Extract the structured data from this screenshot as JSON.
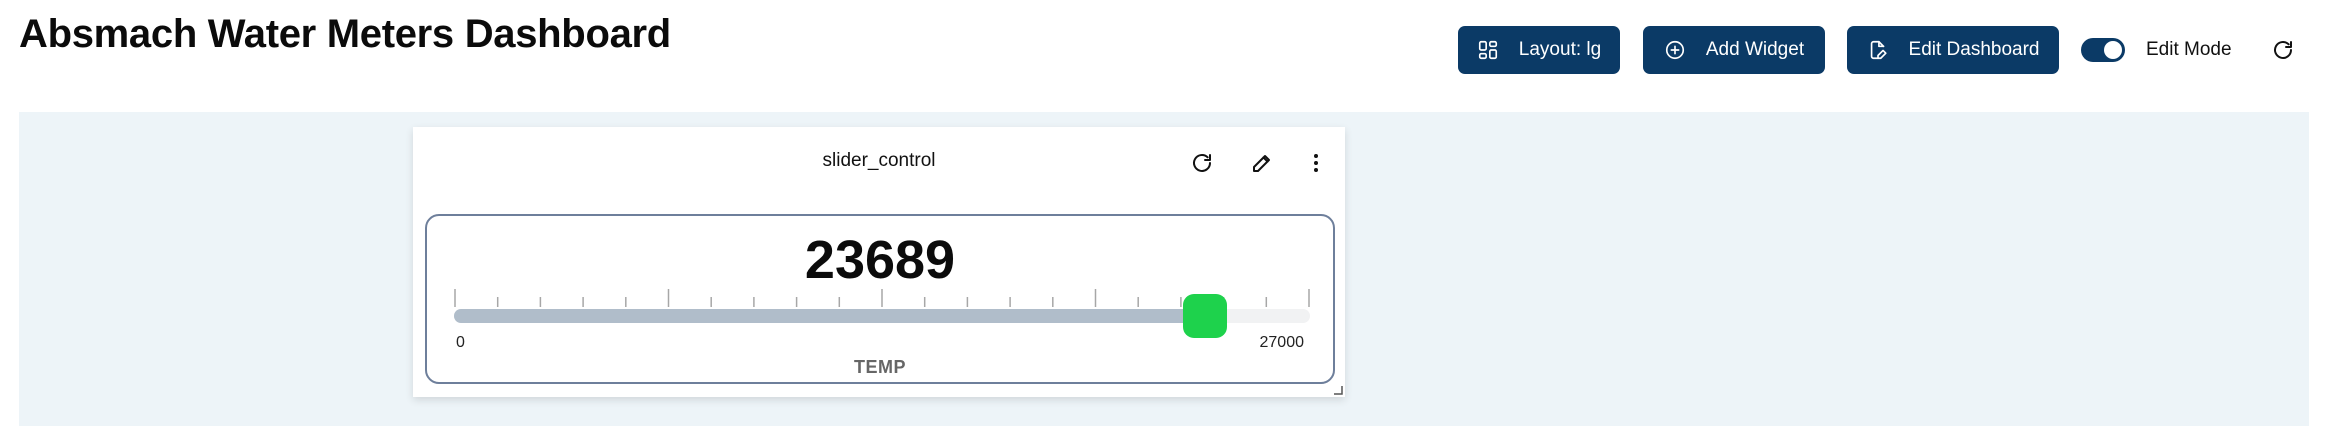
{
  "header": {
    "title": "Absmach Water Meters Dashboard",
    "layout_button": {
      "label": "Layout: lg",
      "icon": "layout-grid-icon"
    },
    "add_widget_button": {
      "label": "Add Widget",
      "icon": "plus-circle-icon"
    },
    "edit_dashboard_button": {
      "label": "Edit Dashboard",
      "icon": "edit-document-icon"
    },
    "edit_mode": {
      "label": "Edit Mode",
      "enabled": true
    },
    "refresh_icon": "refresh-icon"
  },
  "widget": {
    "title": "slider_control",
    "actions": [
      "refresh-icon",
      "pencil-icon",
      "more-vertical-icon"
    ],
    "slider": {
      "value": "23689",
      "numeric_value": 23689,
      "min": "0",
      "max": "27000",
      "min_value": 0,
      "max_value": 27000,
      "label": "TEMP",
      "tick_count": 21
    }
  },
  "colors": {
    "primary": "#0b3a66",
    "canvas_bg": "#edf4f8",
    "thumb": "#1ed24c",
    "track_fill": "#b0bdca",
    "panel_border": "#6e7f9b"
  }
}
